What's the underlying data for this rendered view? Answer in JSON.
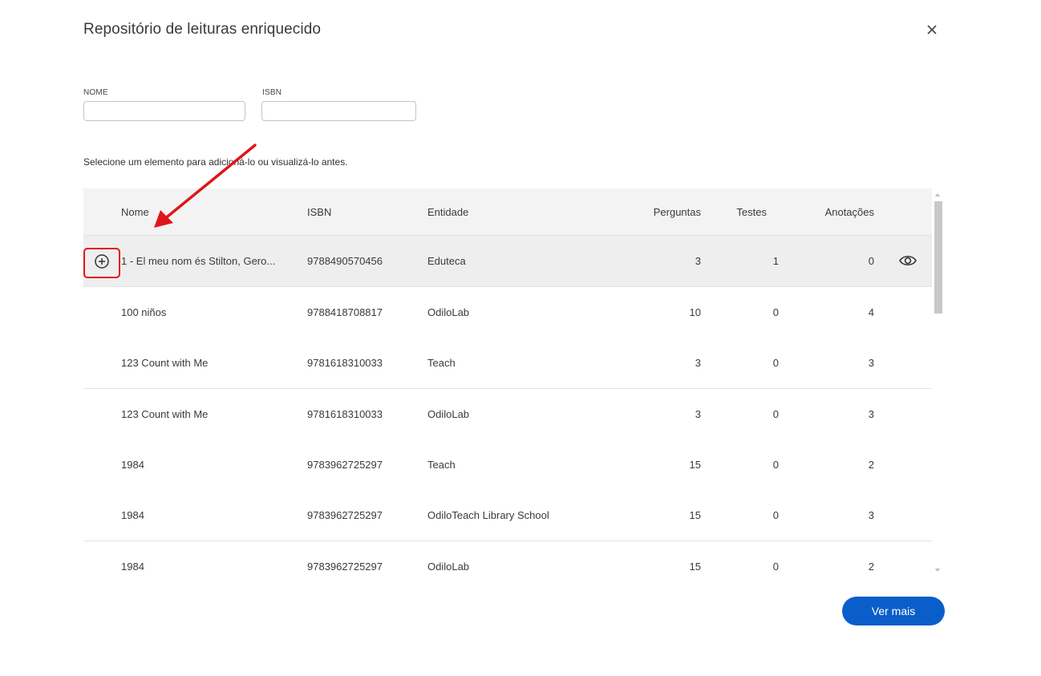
{
  "modal": {
    "title": "Repositório de leituras enriquecido",
    "close_label": "×"
  },
  "filters": {
    "name_label": "NOME",
    "name_value": "",
    "isbn_label": "ISBN",
    "isbn_value": ""
  },
  "instruction": "Selecione um elemento para adicioná-lo ou visualizá-lo antes.",
  "table": {
    "headers": {
      "nome": "Nome",
      "isbn": "ISBN",
      "entidade": "Entidade",
      "perguntas": "Perguntas",
      "testes": "Testes",
      "anotacoes": "Anotações"
    },
    "rows": [
      {
        "nome": "1 - El meu nom és Stilton, Gero...",
        "isbn": "9788490570456",
        "entidade": "Eduteca",
        "perguntas": "3",
        "testes": "1",
        "anotacoes": "0"
      },
      {
        "nome": "100 niños",
        "isbn": "9788418708817",
        "entidade": "OdiloLab",
        "perguntas": "10",
        "testes": "0",
        "anotacoes": "4"
      },
      {
        "nome": "123 Count with Me",
        "isbn": "9781618310033",
        "entidade": "Teach",
        "perguntas": "3",
        "testes": "0",
        "anotacoes": "3"
      },
      {
        "nome": "123 Count with Me",
        "isbn": "9781618310033",
        "entidade": "OdiloLab",
        "perguntas": "3",
        "testes": "0",
        "anotacoes": "3"
      },
      {
        "nome": "1984",
        "isbn": "9783962725297",
        "entidade": "Teach",
        "perguntas": "15",
        "testes": "0",
        "anotacoes": "2"
      },
      {
        "nome": "1984",
        "isbn": "9783962725297",
        "entidade": "OdiloTeach Library School",
        "perguntas": "15",
        "testes": "0",
        "anotacoes": "3"
      },
      {
        "nome": "1984",
        "isbn": "9783962725297",
        "entidade": "OdiloLab",
        "perguntas": "15",
        "testes": "0",
        "anotacoes": "2"
      }
    ]
  },
  "actions": {
    "ver_mais": "Ver mais"
  },
  "icons": {
    "add": "plus-circle-icon",
    "preview": "eye-icon",
    "close": "close-icon"
  },
  "colors": {
    "primary": "#0a5ec9",
    "annotation": "#e0141c",
    "row_highlight": "#eeeeee",
    "header_bg": "#f3f3f3"
  }
}
